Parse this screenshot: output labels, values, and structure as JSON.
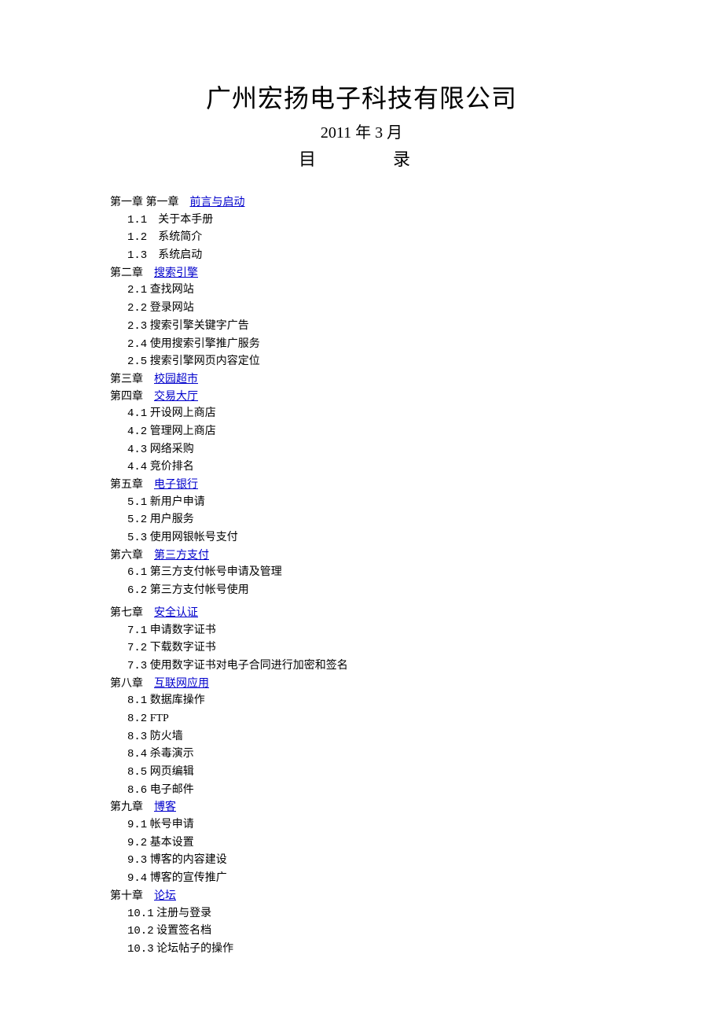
{
  "header": {
    "company": "广州宏扬电子科技有限公司",
    "date": "2011 年 3 月",
    "toc_label": "目　　录"
  },
  "chapters": [
    {
      "prefix": "第一章 第一章　",
      "link": "前言与启动",
      "sections": [
        {
          "num": "1.1",
          "label": "　关于本手册"
        },
        {
          "num": "1.2",
          "label": "　系统简介"
        },
        {
          "num": "1.3",
          "label": "　系统启动"
        }
      ]
    },
    {
      "prefix": "第二章　",
      "link": "搜索引擎",
      "sections": [
        {
          "num": "2.1",
          "label": " 查找网站"
        },
        {
          "num": "2.2",
          "label": " 登录网站"
        },
        {
          "num": "2.3",
          "label": " 搜索引擎关键字广告"
        },
        {
          "num": "2.4",
          "label": " 使用搜索引擎推广服务"
        },
        {
          "num": "2.5",
          "label": " 搜索引擎网页内容定位"
        }
      ]
    },
    {
      "prefix": "第三章　",
      "link": "校园超市",
      "sections": []
    },
    {
      "prefix": "第四章　",
      "link": "交易大厅",
      "sections": [
        {
          "num": "4.1",
          "label": " 开设网上商店"
        },
        {
          "num": "4.2",
          "label": " 管理网上商店"
        },
        {
          "num": "4.3",
          "label": " 网络采购"
        },
        {
          "num": "4.4",
          "label": " 竞价排名"
        }
      ]
    },
    {
      "prefix": "第五章　",
      "link": "电子银行",
      "sections": [
        {
          "num": "5.1",
          "label": " 新用户申请"
        },
        {
          "num": "5.2",
          "label": " 用户服务"
        },
        {
          "num": "5.3",
          "label": " 使用网银帐号支付"
        }
      ]
    },
    {
      "prefix": "第六章　",
      "link": "第三方支付",
      "sections": [
        {
          "num": "6.1",
          "label": " 第三方支付帐号申请及管理"
        },
        {
          "num": "6.2",
          "label": " 第三方支付帐号使用"
        }
      ],
      "gap_after_sections": true
    },
    {
      "prefix": "第七章　",
      "link": "安全认证",
      "sections": [
        {
          "num": "7.1",
          "label": " 申请数字证书"
        },
        {
          "num": "7.2",
          "label": " 下载数字证书"
        },
        {
          "num": "7.3",
          "label": " 使用数字证书对电子合同进行加密和签名"
        }
      ]
    },
    {
      "prefix": "第八章　",
      "link": "互联网应用",
      "sections": [
        {
          "num": "8.1",
          "label": " 数据库操作"
        },
        {
          "num": "8.2",
          "label": " FTP"
        },
        {
          "num": "8.3",
          "label": " 防火墙"
        },
        {
          "num": "8.4",
          "label": " 杀毒演示"
        },
        {
          "num": "8.5",
          "label": " 网页编辑"
        },
        {
          "num": "8.6",
          "label": " 电子邮件"
        }
      ]
    },
    {
      "prefix": "第九章　",
      "link": "博客 ",
      "sections": [
        {
          "num": "9.1",
          "label": " 帐号申请"
        },
        {
          "num": "9.2",
          "label": " 基本设置"
        },
        {
          "num": "9.3",
          "label": " 博客的内容建设"
        },
        {
          "num": "9.4",
          "label": " 博客的宣传推广"
        }
      ]
    },
    {
      "prefix": "第十章　",
      "link": "论坛 ",
      "sections": [
        {
          "num": "10.1",
          "label": " 注册与登录"
        },
        {
          "num": "10.2",
          "label": " 设置签名档"
        },
        {
          "num": "10.3",
          "label": " 论坛帖子的操作"
        }
      ]
    }
  ]
}
